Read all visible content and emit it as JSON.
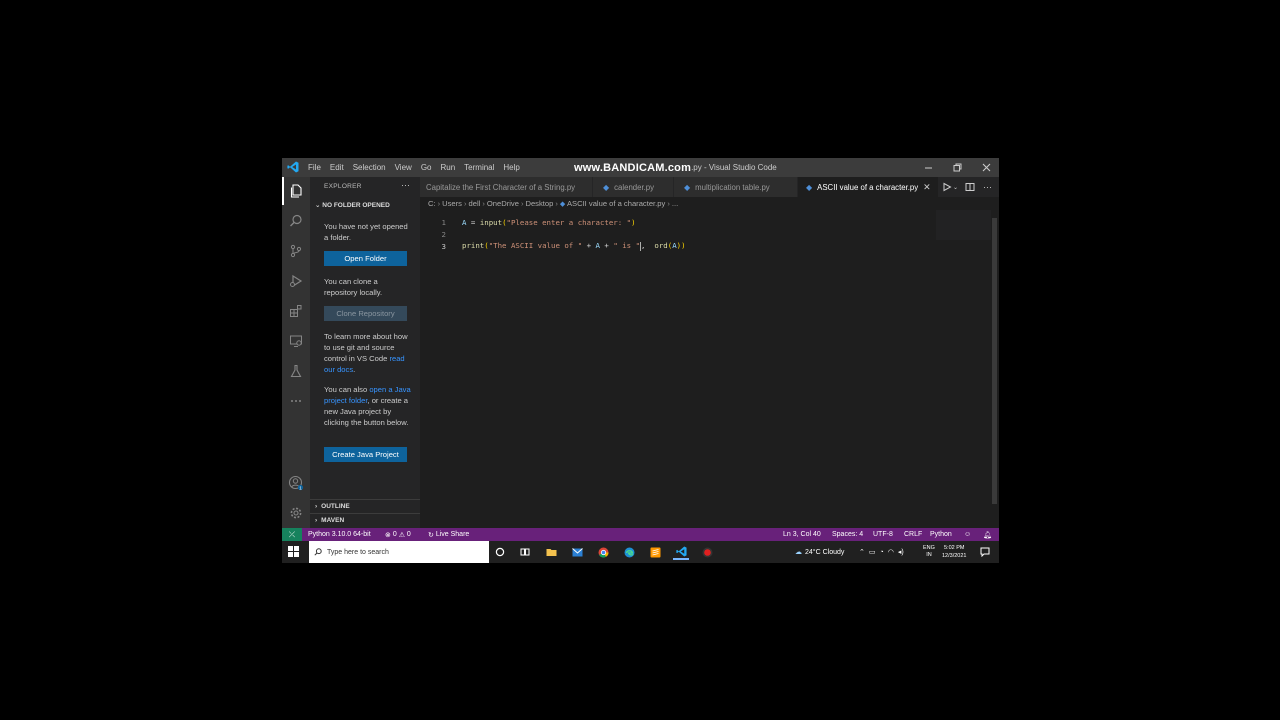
{
  "watermark": "www.BANDICAM.com",
  "window": {
    "title_rest": ".py - Visual Studio Code",
    "menu": [
      "File",
      "Edit",
      "Selection",
      "View",
      "Go",
      "Run",
      "Terminal",
      "Help"
    ]
  },
  "sidebar": {
    "header": "EXPLORER",
    "section": "NO FOLDER OPENED",
    "p1": "You have not yet opened a folder.",
    "open_folder": "Open Folder",
    "p2": "You can clone a repository locally.",
    "clone_repo": "Clone Repository",
    "p3_pre": "To learn more about how to use git and source control in VS Code ",
    "p3_link": "read our docs",
    "p3_post": ".",
    "p4_pre": "You can also ",
    "p4_link": "open a Java project folder",
    "p4_post": ", or create a new Java project by clicking the button below.",
    "create_java": "Create Java Project",
    "outline": "OUTLINE",
    "maven": "MAVEN"
  },
  "tabs": [
    {
      "label": "Capitalize the First Character of a String.py",
      "active": false
    },
    {
      "label": "calender.py",
      "active": false
    },
    {
      "label": "multiplication table.py",
      "active": false
    },
    {
      "label": "ASCII value of a character.py",
      "active": true
    }
  ],
  "breadcrumb": [
    "C:",
    "Users",
    "dell",
    "OneDrive",
    "Desktop",
    "ASCII value of a character.py",
    "..."
  ],
  "editor": {
    "lines": [
      {
        "num": "1",
        "parts": [
          [
            "t-var",
            "A"
          ],
          [
            "t-op",
            " = "
          ],
          [
            "t-fn",
            "input"
          ],
          [
            "t-paren",
            "("
          ],
          [
            "t-str",
            "\"Please enter a character: \""
          ],
          [
            "t-paren",
            ")"
          ]
        ]
      },
      {
        "num": "2",
        "parts": []
      },
      {
        "num": "3",
        "parts": [
          [
            "t-fn",
            "print"
          ],
          [
            "t-paren",
            "("
          ],
          [
            "t-str",
            "\"The ASCII value of \""
          ],
          [
            "t-op",
            " + "
          ],
          [
            "t-var",
            "A"
          ],
          [
            "t-op",
            " + "
          ],
          [
            "t-str",
            "\" is \""
          ],
          [
            "t-op",
            ",  "
          ],
          [
            "t-fn",
            "ord"
          ],
          [
            "t-paren",
            "("
          ],
          [
            "t-var",
            "A"
          ],
          [
            "t-paren",
            "))"
          ]
        ]
      }
    ]
  },
  "statusbar": {
    "interpreter": "Python 3.10.0 64-bit",
    "errors": "0",
    "warnings": "0",
    "live_share": "Live Share",
    "position": "Ln 3, Col 40",
    "spaces": "Spaces: 4",
    "encoding": "UTF-8",
    "eol": "CRLF",
    "language": "Python"
  },
  "taskbar": {
    "search_placeholder": "Type here to search",
    "weather": "24°C  Cloudy",
    "lang_top": "ENG",
    "lang_bottom": "IN",
    "time": "5:02 PM",
    "date": "12/3/2021"
  },
  "colors": {
    "accent": "#0e639c",
    "statusbar": "#68217a",
    "remote": "#16825d"
  }
}
